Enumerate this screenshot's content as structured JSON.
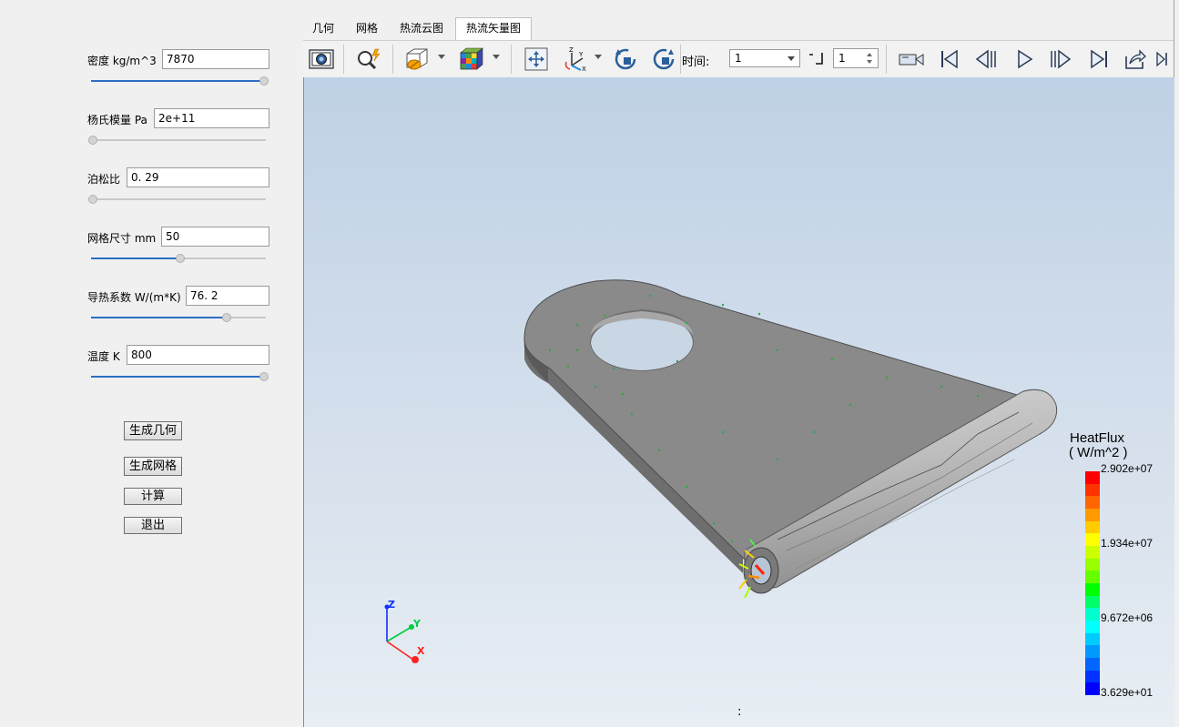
{
  "params": [
    {
      "label": "密度 kg/m^3",
      "value": "7870",
      "slider_fraction": 1.0
    },
    {
      "label": "杨氏模量 Pa",
      "value": "2e+11",
      "slider_fraction": 0.0
    },
    {
      "label": "泊松比",
      "value": "0. 29",
      "slider_fraction": 0.0
    },
    {
      "label": "网格尺寸 mm",
      "value": "50",
      "slider_fraction": 0.51
    },
    {
      "label": "导热系数 W/(m*K)",
      "value": "76. 2",
      "slider_fraction": 0.78
    },
    {
      "label": "温度 K",
      "value": "800",
      "slider_fraction": 1.0
    }
  ],
  "buttons": {
    "generate_geometry": "生成几何",
    "generate_mesh": "生成网格",
    "compute": "计算",
    "exit": "退出"
  },
  "tabs": [
    {
      "label": "几何",
      "active": false
    },
    {
      "label": "网格",
      "active": false
    },
    {
      "label": "热流云图",
      "active": false
    },
    {
      "label": "热流矢量图",
      "active": true
    }
  ],
  "toolbar": {
    "icons": [
      "camera-icon",
      "zoom-icon",
      "view-box-icon",
      "color-cube-icon",
      "fit-icon",
      "axes-icon",
      "rotate-ccw-icon",
      "rotate-cw-icon"
    ],
    "time_label": "时间:",
    "time_value": "1",
    "step_value": "1",
    "playback_icons": [
      "record-icon",
      "first-frame-icon",
      "prev-frame-icon",
      "play-icon",
      "next-frame-icon",
      "last-frame-icon",
      "export-icon"
    ]
  },
  "legend": {
    "title": "HeatFlux",
    "unit": "( W/m^2 )",
    "labels": [
      "2.902e+07",
      "1.934e+07",
      "9.672e+06",
      "3.629e+01"
    ],
    "colors": [
      "#ff0000",
      "#ff3300",
      "#ff6600",
      "#ff9900",
      "#ffcc00",
      "#ffff00",
      "#ccff00",
      "#99ff00",
      "#66ff00",
      "#00ff00",
      "#00ff66",
      "#00ffcc",
      "#00ffff",
      "#00ccff",
      "#0099ff",
      "#0066ff",
      "#0033ff",
      "#0000ff"
    ]
  },
  "axes": {
    "x": "X",
    "y": "Y",
    "z": "Z"
  },
  "status_text": ":"
}
